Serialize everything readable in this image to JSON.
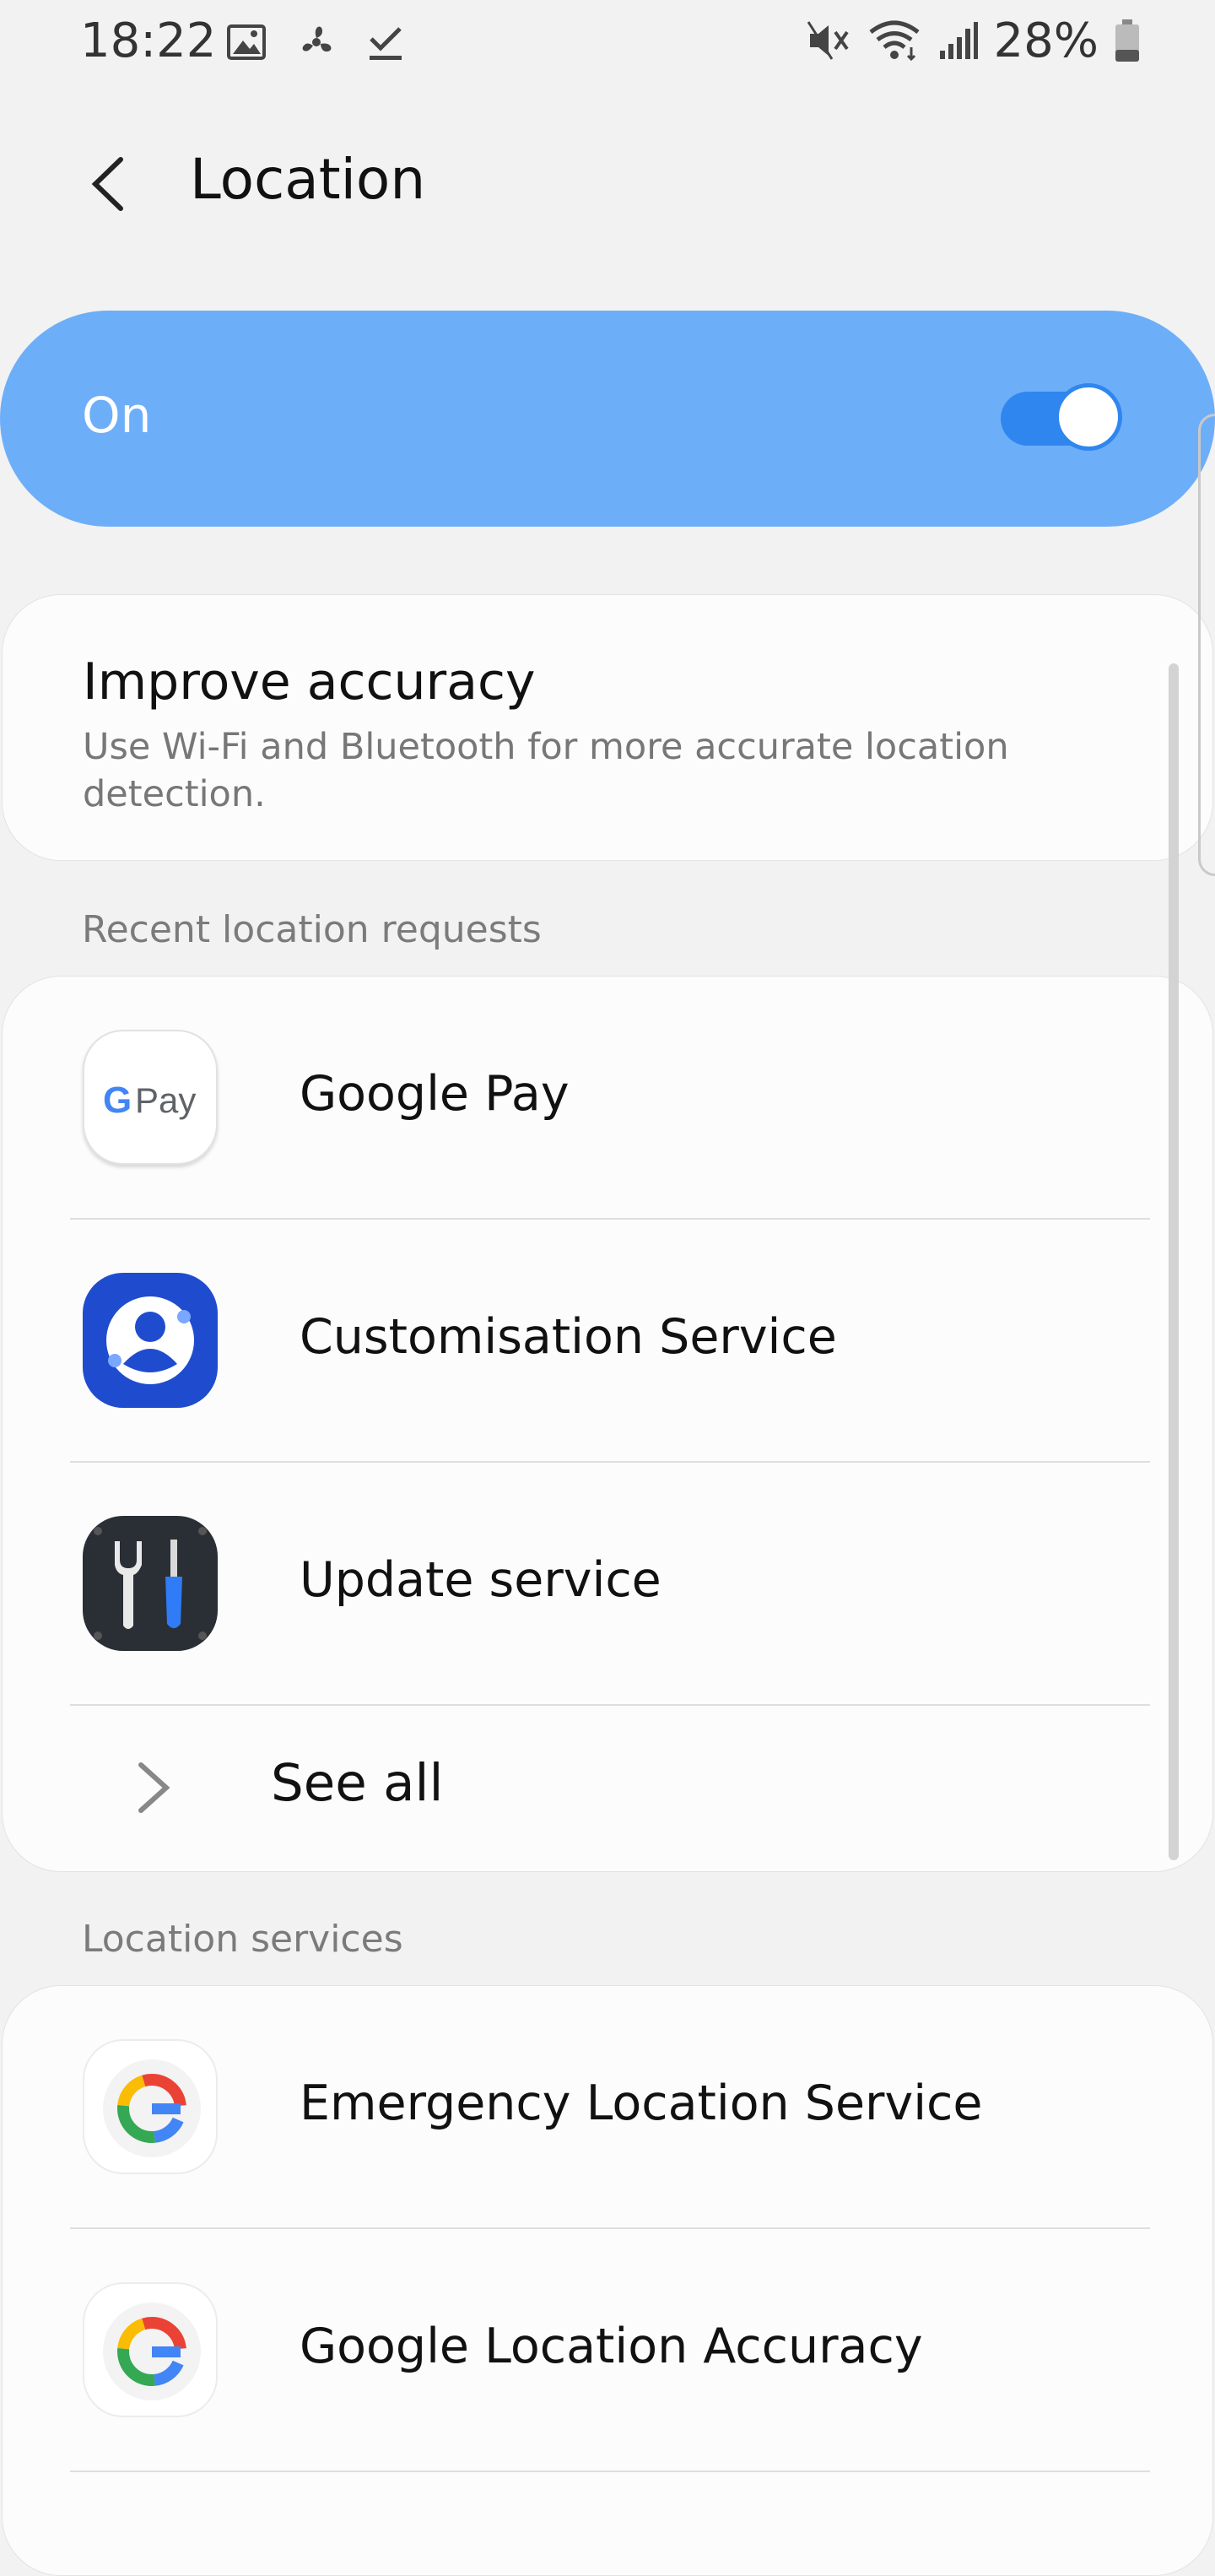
{
  "status_bar": {
    "time": "18:22",
    "battery_percent": "28%",
    "left_icons": [
      "gallery-icon",
      "fan-icon",
      "check-download-icon"
    ],
    "right_icons": [
      "mute-icon",
      "wifi-icon",
      "signal-icon",
      "battery-icon"
    ]
  },
  "header": {
    "title": "Location",
    "back_icon": "chevron-left-icon"
  },
  "master_switch": {
    "label": "On",
    "state": true
  },
  "improve_accuracy": {
    "title": "Improve accuracy",
    "subtitle": "Use Wi-Fi and Bluetooth for more accurate location detection."
  },
  "recent_requests": {
    "section_label": "Recent location requests",
    "items": [
      {
        "label": "Google Pay",
        "icon": "google-pay-icon",
        "icon_text": "Pay"
      },
      {
        "label": "Customisation Service",
        "icon": "customisation-service-icon"
      },
      {
        "label": "Update service",
        "icon": "update-service-icon"
      }
    ],
    "see_all_label": "See all"
  },
  "location_services": {
    "section_label": "Location services",
    "items": [
      {
        "label": "Emergency Location Service",
        "icon": "google-g-icon"
      },
      {
        "label": "Google Location Accuracy",
        "icon": "google-g-icon"
      }
    ]
  },
  "colors": {
    "banner": "#6daef9",
    "toggle_on": "#2f86ef",
    "background": "#f2f2f2",
    "card": "#fcfcfc",
    "customisation_blue": "#1f4ccf",
    "update_dark": "#2a2f36"
  }
}
